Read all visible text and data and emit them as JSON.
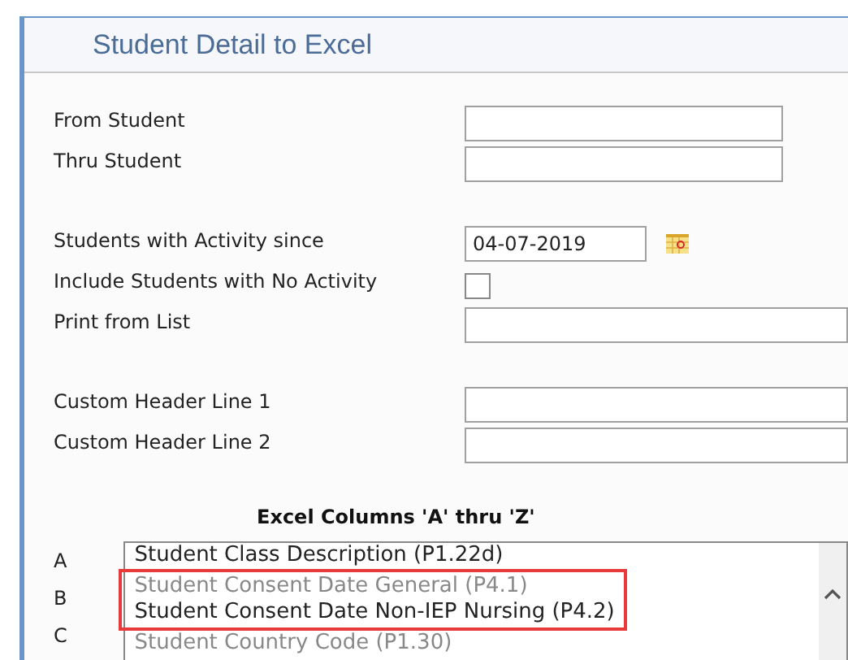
{
  "panel": {
    "title": "Student Detail to Excel"
  },
  "fields": [
    {
      "label": "From Student",
      "kind": "text"
    },
    {
      "label": "Thru Student",
      "kind": "text"
    },
    {
      "kind": "gap"
    },
    {
      "label": "Students with Activity since",
      "kind": "date",
      "value": "04-07-2019"
    },
    {
      "label": "Include Students with No Activity",
      "kind": "checkbox",
      "checked": false
    },
    {
      "label": "Print from List",
      "kind": "wide"
    },
    {
      "kind": "gap"
    },
    {
      "label": "Custom Header Line 1",
      "kind": "wide"
    },
    {
      "label": "Custom Header Line 2",
      "kind": "wide"
    }
  ],
  "columns": {
    "heading": "Excel Columns 'A' thru 'Z'",
    "letters": [
      "A",
      "B",
      "C"
    ],
    "options": [
      {
        "text": "Student Class Description (P1.22d)",
        "dark": true,
        "boxed": false
      },
      {
        "text": "Student Consent Date General (P4.1)",
        "dark": false,
        "boxed": true
      },
      {
        "text": "Student Consent Date Non-IEP Nursing (P4.2)",
        "dark": true,
        "boxed": true
      },
      {
        "text": "Student Country Code (P1.30)",
        "dark": false,
        "boxed": false
      }
    ]
  }
}
